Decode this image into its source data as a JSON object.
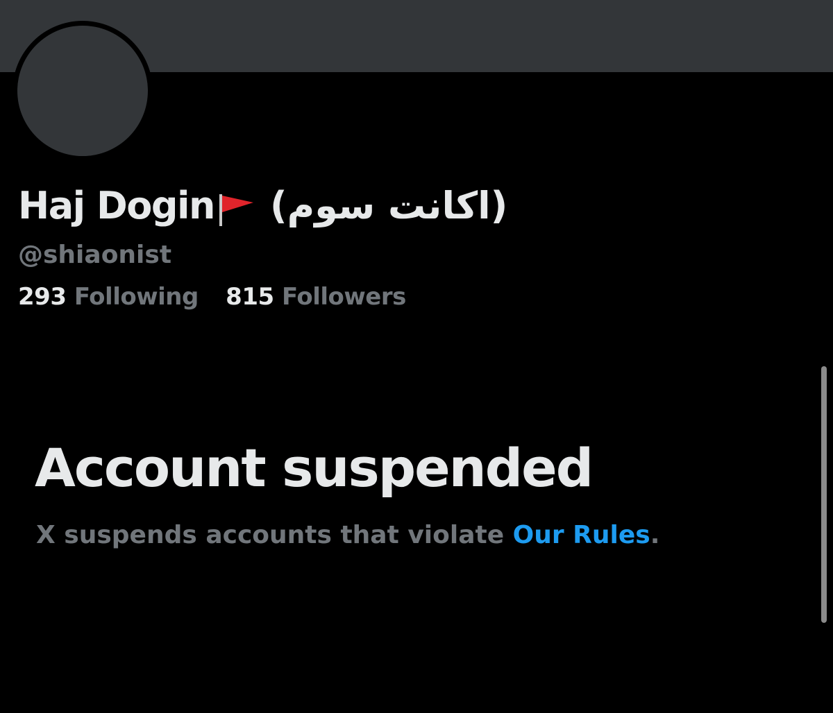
{
  "profile": {
    "display_name": "Haj Dogin",
    "flag_emoji": "🚩",
    "name_suffix": "(اکانت سوم)",
    "handle": "@shiaonist",
    "following_count": "293",
    "following_label": "Following",
    "followers_count": "815",
    "followers_label": "Followers"
  },
  "suspension": {
    "title": "Account suspended",
    "description_prefix": "X suspends accounts that violate ",
    "link_text": "Our Rules",
    "description_suffix": "."
  },
  "colors": {
    "background": "#000000",
    "banner": "#333639",
    "primary_text": "#e7e9ea",
    "secondary_text": "#71767b",
    "link": "#1d9bf0",
    "flag": "#e0242b"
  },
  "icons": {
    "flag": "triangular-flag-icon"
  }
}
